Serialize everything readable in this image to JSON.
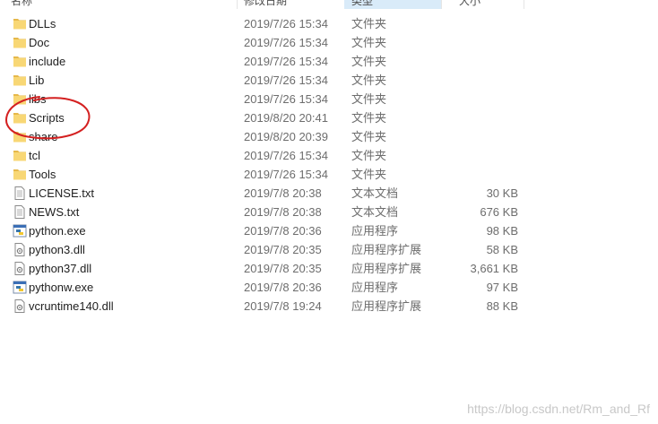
{
  "header": {
    "name_label": "名称",
    "date_label": "修改日期",
    "type_label": "类型",
    "size_label": "大小"
  },
  "files": [
    {
      "name": "DLLs",
      "date": "2019/7/26 15:34",
      "type": "文件夹",
      "size": "",
      "icon": "folder-icon"
    },
    {
      "name": "Doc",
      "date": "2019/7/26 15:34",
      "type": "文件夹",
      "size": "",
      "icon": "folder-icon"
    },
    {
      "name": "include",
      "date": "2019/7/26 15:34",
      "type": "文件夹",
      "size": "",
      "icon": "folder-icon"
    },
    {
      "name": "Lib",
      "date": "2019/7/26 15:34",
      "type": "文件夹",
      "size": "",
      "icon": "folder-icon"
    },
    {
      "name": "libs",
      "date": "2019/7/26 15:34",
      "type": "文件夹",
      "size": "",
      "icon": "folder-icon"
    },
    {
      "name": "Scripts",
      "date": "2019/8/20 20:41",
      "type": "文件夹",
      "size": "",
      "icon": "folder-icon"
    },
    {
      "name": "share",
      "date": "2019/8/20 20:39",
      "type": "文件夹",
      "size": "",
      "icon": "folder-icon"
    },
    {
      "name": "tcl",
      "date": "2019/7/26 15:34",
      "type": "文件夹",
      "size": "",
      "icon": "folder-icon"
    },
    {
      "name": "Tools",
      "date": "2019/7/26 15:34",
      "type": "文件夹",
      "size": "",
      "icon": "folder-icon"
    },
    {
      "name": "LICENSE.txt",
      "date": "2019/7/8 20:38",
      "type": "文本文档",
      "size": "30 KB",
      "icon": "text-file-icon"
    },
    {
      "name": "NEWS.txt",
      "date": "2019/7/8 20:38",
      "type": "文本文档",
      "size": "676 KB",
      "icon": "text-file-icon"
    },
    {
      "name": "python.exe",
      "date": "2019/7/8 20:36",
      "type": "应用程序",
      "size": "98 KB",
      "icon": "python-exe-icon"
    },
    {
      "name": "python3.dll",
      "date": "2019/7/8 20:35",
      "type": "应用程序扩展",
      "size": "58 KB",
      "icon": "dll-file-icon"
    },
    {
      "name": "python37.dll",
      "date": "2019/7/8 20:35",
      "type": "应用程序扩展",
      "size": "3,661 KB",
      "icon": "dll-file-icon"
    },
    {
      "name": "pythonw.exe",
      "date": "2019/7/8 20:36",
      "type": "应用程序",
      "size": "97 KB",
      "icon": "python-exe-icon"
    },
    {
      "name": "vcruntime140.dll",
      "date": "2019/7/8 19:24",
      "type": "应用程序扩展",
      "size": "88 KB",
      "icon": "dll-file-icon"
    }
  ],
  "watermark": "https://blog.csdn.net/Rm_and_Rf",
  "colors": {
    "folder": "#f8d775",
    "folder_dark": "#e6b84a",
    "annotation": "#d42020",
    "sorted_header": "#d9ebf9"
  }
}
